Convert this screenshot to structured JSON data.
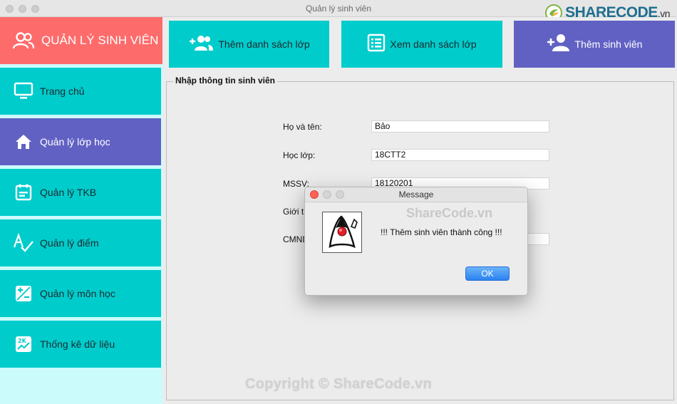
{
  "window": {
    "title": "Quản lý sinh viên"
  },
  "brand": {
    "name": "SHARECODE",
    "suffix": ".vn"
  },
  "sidebar": {
    "header": {
      "label": "QUẢN LÝ SINH VIÊN",
      "icon": "users-icon",
      "color": "#fe6b6b"
    },
    "items": [
      {
        "label": "Trang chủ",
        "icon": "monitor-icon",
        "color": "#00cccc"
      },
      {
        "label": "Quản lý lớp học",
        "icon": "home-icon",
        "color": "#6161c4"
      },
      {
        "label": "Quản lý TKB",
        "icon": "calendar-icon",
        "color": "#00cccc"
      },
      {
        "label": "Quản lý điểm",
        "icon": "spellcheck-icon",
        "color": "#00cccc"
      },
      {
        "label": "Quản lý môn học",
        "icon": "plus-minus-icon",
        "color": "#00cccc"
      },
      {
        "label": "Thống kê dữ liệu",
        "icon": "chart-icon",
        "color": "#00cccc"
      }
    ],
    "background": "#ccfbfb"
  },
  "topbar": {
    "buttons": [
      {
        "label": "Thêm danh sách lớp",
        "icon": "group-add-icon",
        "color": "#00cccc"
      },
      {
        "label": "Xem danh sách lớp",
        "icon": "list-icon",
        "color": "#00cccc"
      },
      {
        "label": "Thêm sinh viên",
        "icon": "person-add-icon",
        "color": "#6161c4"
      }
    ]
  },
  "form": {
    "title": "Nhập thông tin sinh viên",
    "fields": [
      {
        "label": "Họ và tên:",
        "value": "Bảo"
      },
      {
        "label": "Học lớp:",
        "value": "18CTT2"
      },
      {
        "label": "MSSV:",
        "value": "18120201"
      },
      {
        "label": "Giới t",
        "value": ""
      },
      {
        "label": "CMND",
        "value": ""
      }
    ]
  },
  "dialog": {
    "title": "Message",
    "message": "!!! Thêm sinh viên thành công !!!",
    "ok_label": "OK",
    "watermark": "ShareCode.vn",
    "icon": "java-duke-icon"
  },
  "watermark": {
    "text": "Copyright © ShareCode.vn"
  }
}
